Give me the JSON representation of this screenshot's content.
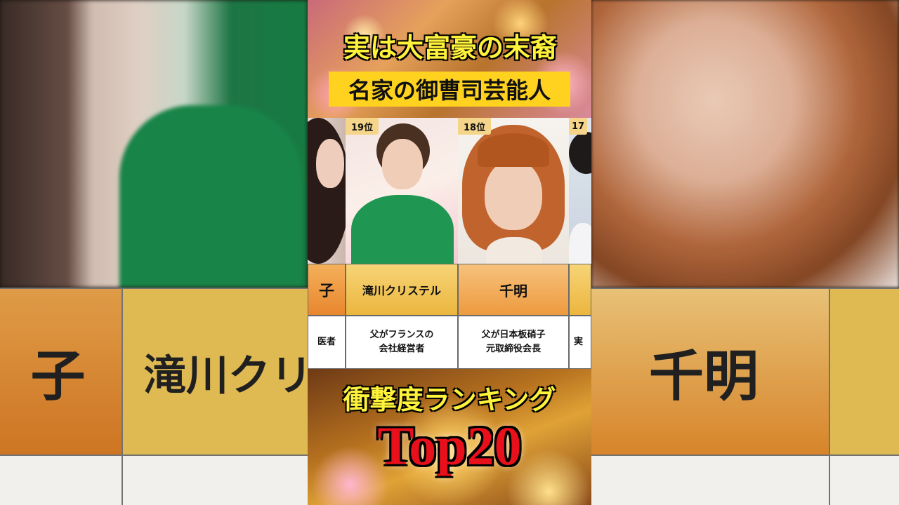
{
  "title_top": "実は大富豪の末裔",
  "title_sub": "名家の御曹司芸能人",
  "ranking_label": "衝撃度ランキング",
  "top_label": "Top20",
  "backdrop": {
    "left_name_1": "子",
    "left_name_2": "滝川クリ",
    "right_name_1": "千明"
  },
  "columns": [
    {
      "rank": "",
      "name": "子",
      "desc": "医者"
    },
    {
      "rank": "19位",
      "name": "滝川クリステル",
      "desc": "父がフランスの\n会社経営者"
    },
    {
      "rank": "18位",
      "name": "千明",
      "desc": "父が日本板硝子\n元取締役会長"
    },
    {
      "rank": "17",
      "name": "",
      "desc": "実"
    }
  ],
  "colors": {
    "title_yellow": "#fff23a",
    "subtitle_bg": "#ffd21f",
    "top20_red": "#e8101a",
    "name_cell_orange": "#f0a743",
    "name_cell_gold": "#f2c35a",
    "rank_badge": "#f4d58a"
  }
}
